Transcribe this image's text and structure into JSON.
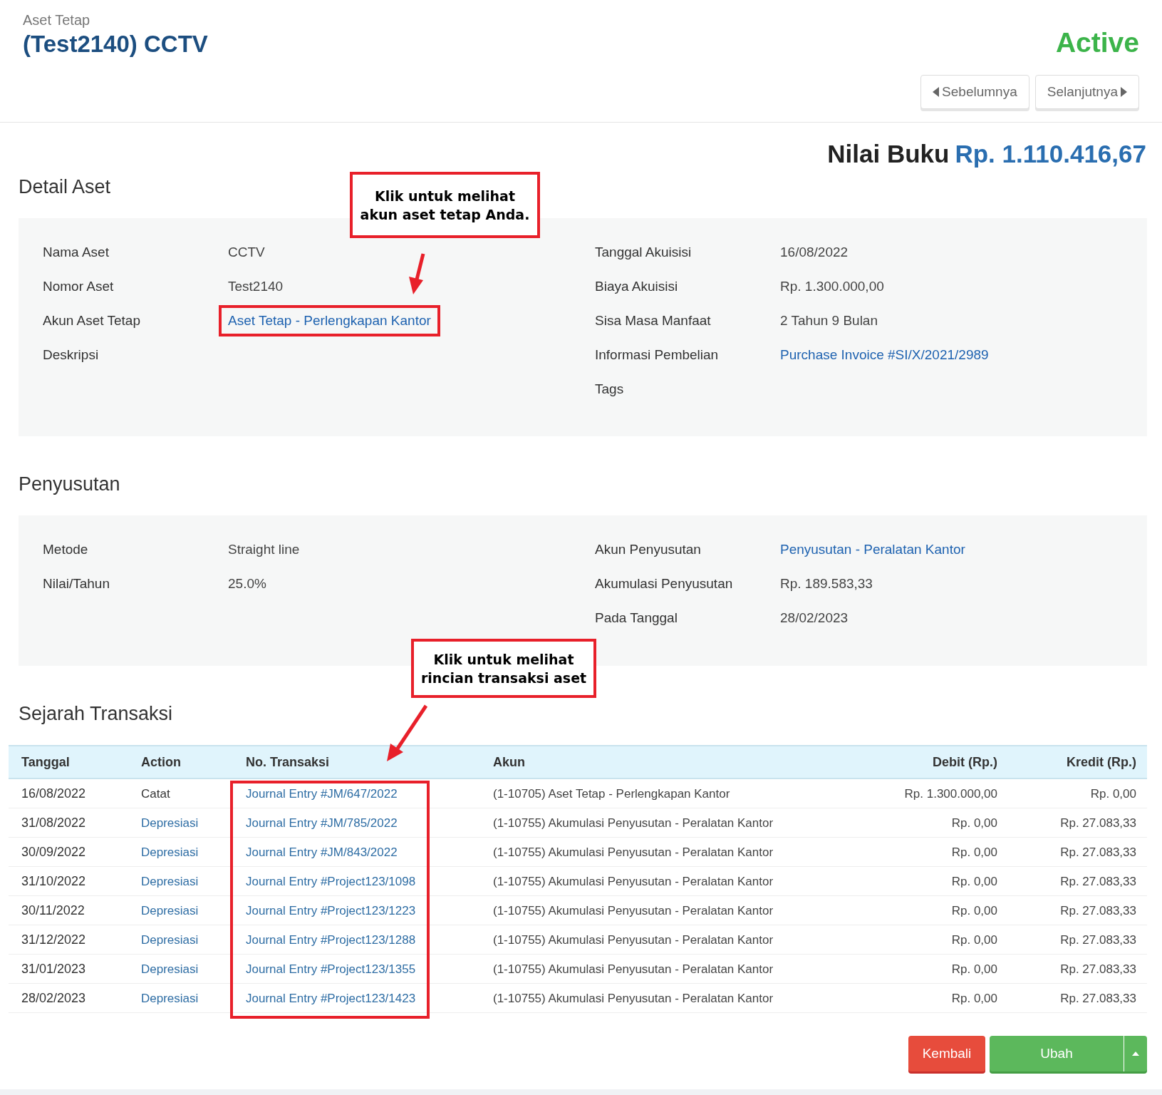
{
  "header": {
    "breadcrumb": "Aset Tetap",
    "title": "(Test2140) CCTV",
    "status": "Active",
    "prev_button": "Sebelumnya",
    "next_button": "Selanjutnya"
  },
  "book_value": {
    "label": "Nilai Buku",
    "value": "Rp. 1.110.416,67"
  },
  "detail": {
    "heading": "Detail Aset",
    "left": [
      {
        "label": "Nama Aset",
        "value": "CCTV",
        "link": false
      },
      {
        "label": "Nomor Aset",
        "value": "Test2140",
        "link": false
      },
      {
        "label": "Akun Aset Tetap",
        "value": "Aset Tetap - Perlengkapan Kantor",
        "link": true
      },
      {
        "label": "Deskripsi"
      }
    ],
    "right": [
      {
        "label": "Tanggal Akuisisi",
        "value": "16/08/2022",
        "link": false
      },
      {
        "label": "Biaya Akuisisi",
        "value": "Rp. 1.300.000,00",
        "link": false
      },
      {
        "label": "Sisa Masa Manfaat",
        "value": "2 Tahun 9 Bulan",
        "link": false
      },
      {
        "label": "Informasi Pembelian",
        "value": "Purchase Invoice #SI/X/2021/2989",
        "link": true
      },
      {
        "label": "Tags"
      }
    ]
  },
  "depreciation": {
    "heading": "Penyusutan",
    "left": [
      {
        "label": "Metode",
        "value": "Straight line",
        "link": false
      },
      {
        "label": "Nilai/Tahun",
        "value": "25.0%",
        "link": false
      }
    ],
    "right": [
      {
        "label": "Akun Penyusutan",
        "value": "Penyusutan - Peralatan Kantor",
        "link": true
      },
      {
        "label": "Akumulasi Penyusutan",
        "value": "Rp. 189.583,33",
        "link": false
      },
      {
        "label": "Pada Tanggal",
        "value": "28/02/2023",
        "link": false
      }
    ]
  },
  "transactions": {
    "heading": "Sejarah Transaksi",
    "columns": [
      "Tanggal",
      "Action",
      "No. Transaksi",
      "Akun",
      "Debit (Rp.)",
      "Kredit (Rp.)"
    ],
    "rows": [
      {
        "date": "16/08/2022",
        "action": "Catat",
        "action_link": false,
        "number": "Journal Entry #JM/647/2022",
        "account": "(1-10705) Aset Tetap - Perlengkapan Kantor",
        "debit": "Rp. 1.300.000,00",
        "credit": "Rp. 0,00"
      },
      {
        "date": "31/08/2022",
        "action": "Depresiasi",
        "action_link": true,
        "number": "Journal Entry #JM/785/2022",
        "account": "(1-10755) Akumulasi Penyusutan - Peralatan Kantor",
        "debit": "Rp. 0,00",
        "credit": "Rp. 27.083,33"
      },
      {
        "date": "30/09/2022",
        "action": "Depresiasi",
        "action_link": true,
        "number": "Journal Entry #JM/843/2022",
        "account": "(1-10755) Akumulasi Penyusutan - Peralatan Kantor",
        "debit": "Rp. 0,00",
        "credit": "Rp. 27.083,33"
      },
      {
        "date": "31/10/2022",
        "action": "Depresiasi",
        "action_link": true,
        "number": "Journal Entry #Project123/1098",
        "account": "(1-10755) Akumulasi Penyusutan - Peralatan Kantor",
        "debit": "Rp. 0,00",
        "credit": "Rp. 27.083,33"
      },
      {
        "date": "30/11/2022",
        "action": "Depresiasi",
        "action_link": true,
        "number": "Journal Entry #Project123/1223",
        "account": "(1-10755) Akumulasi Penyusutan - Peralatan Kantor",
        "debit": "Rp. 0,00",
        "credit": "Rp. 27.083,33"
      },
      {
        "date": "31/12/2022",
        "action": "Depresiasi",
        "action_link": true,
        "number": "Journal Entry #Project123/1288",
        "account": "(1-10755) Akumulasi Penyusutan - Peralatan Kantor",
        "debit": "Rp. 0,00",
        "credit": "Rp. 27.083,33"
      },
      {
        "date": "31/01/2023",
        "action": "Depresiasi",
        "action_link": true,
        "number": "Journal Entry #Project123/1355",
        "account": "(1-10755) Akumulasi Penyusutan - Peralatan Kantor",
        "debit": "Rp. 0,00",
        "credit": "Rp. 27.083,33"
      },
      {
        "date": "28/02/2023",
        "action": "Depresiasi",
        "action_link": true,
        "number": "Journal Entry #Project123/1423",
        "account": "(1-10755) Akumulasi Penyusutan - Peralatan Kantor",
        "debit": "Rp. 0,00",
        "credit": "Rp. 27.083,33"
      }
    ]
  },
  "buttons": {
    "back": "Kembali",
    "edit": "Ubah"
  },
  "annotations": [
    {
      "text": "Klik untuk melihat akun aset tetap Anda."
    },
    {
      "text": "Klik untuk melihat rincian transaksi aset"
    }
  ]
}
